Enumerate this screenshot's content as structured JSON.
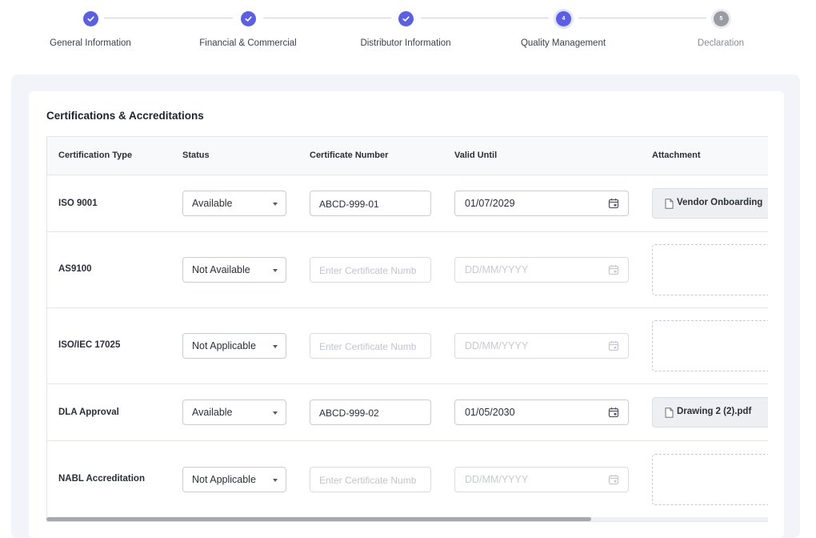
{
  "stepper": {
    "steps": [
      {
        "label": "General Information",
        "state": "done",
        "number": "1"
      },
      {
        "label": "Financial & Commercial",
        "state": "done",
        "number": "2"
      },
      {
        "label": "Distributor Information",
        "state": "done",
        "number": "3"
      },
      {
        "label": "Quality Management",
        "state": "active",
        "number": "4"
      },
      {
        "label": "Declaration",
        "state": "pending",
        "number": "5"
      }
    ]
  },
  "section": {
    "title": "Certifications & Accreditations"
  },
  "table": {
    "headers": {
      "type": "Certification Type",
      "status": "Status",
      "number": "Certificate Number",
      "valid": "Valid Until",
      "attachment": "Attachment"
    },
    "number_placeholder": "Enter Certificate Numb",
    "date_placeholder": "DD/MM/YYYY",
    "rows": [
      {
        "type": "ISO 9001",
        "status": "Available",
        "number": "ABCD-999-01",
        "valid": "01/07/2029",
        "attachment": "Vendor Onboarding"
      },
      {
        "type": "AS9100",
        "status": "Not Available",
        "number": "",
        "valid": "",
        "attachment": ""
      },
      {
        "type": "ISO/IEC 17025",
        "status": "Not Applicable",
        "number": "",
        "valid": "",
        "attachment": ""
      },
      {
        "type": "DLA Approval",
        "status": "Available",
        "number": "ABCD-999-02",
        "valid": "01/05/2030",
        "attachment": "Drawing 2 (2).pdf"
      },
      {
        "type": "NABL Accreditation",
        "status": "Not Applicable",
        "number": "",
        "valid": "",
        "attachment": ""
      }
    ]
  },
  "colors": {
    "accent": "#5b5fe0",
    "pending": "#9a9ca3",
    "panel_bg": "#f2f4fa"
  },
  "icons": {
    "done": "check-icon",
    "calendar": "calendar-icon",
    "attachment": "document-icon",
    "select": "caret-down-icon"
  }
}
